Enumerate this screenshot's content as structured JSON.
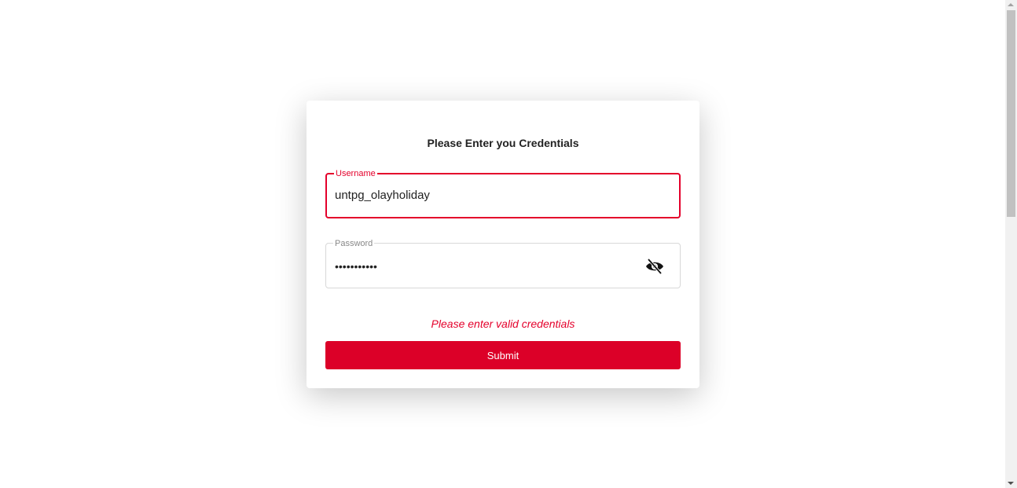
{
  "login": {
    "title": "Please Enter you Credentials",
    "username_label": "Username",
    "username_value": "untpg_olayholiday",
    "password_label": "Password",
    "password_masked": "•••••••••••",
    "password_toggle_icon": "eye-slash-icon",
    "error_message": "Please enter valid credentials",
    "submit_label": "Submit"
  },
  "colors": {
    "accent": "#dc0028",
    "error": "#e4002b"
  }
}
